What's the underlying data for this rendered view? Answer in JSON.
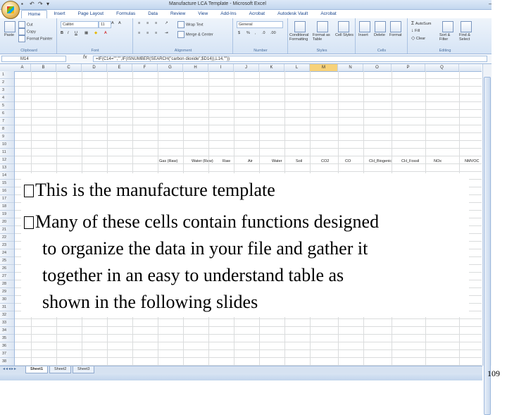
{
  "window": {
    "title": "Manufacture LCA Template - Microsoft Excel",
    "controls": [
      "–",
      "□",
      "✕"
    ]
  },
  "ribbon": {
    "tabs": [
      "Home",
      "Insert",
      "Page Layout",
      "Formulas",
      "Data",
      "Review",
      "View",
      "Add-Ins",
      "Acrobat",
      "Autodesk Vault",
      "Acrobat"
    ],
    "active_tab": "Home",
    "groups": [
      "Clipboard",
      "Font",
      "Alignment",
      "Number",
      "Styles",
      "Cells",
      "Editing"
    ],
    "clipboard": {
      "paste": "Paste",
      "cut": "Cut",
      "copy": "Copy",
      "format_painter": "Format Painter"
    },
    "font": {
      "name": "Calibri",
      "size": "11"
    },
    "alignment": {
      "wrap_text": "Wrap Text",
      "merge_center": "Merge & Center"
    },
    "number": {
      "format": "General"
    },
    "styles": {
      "conditional": "Conditional Formatting",
      "format_table": "Format as Table",
      "cell_styles": "Cell Styles"
    },
    "cells": {
      "insert": "Insert",
      "delete": "Delete",
      "format": "Format"
    },
    "editing": {
      "autosum": "AutoSum",
      "fill": "Fill",
      "clear": "Clear",
      "sort_filter": "Sort & Filter",
      "find_select": "Find & Select"
    }
  },
  "formula_bar": {
    "name_box": "M14",
    "fx": "fx",
    "formula": "=IF(C14=\"\",\"\",IF(ISNUMBER(SEARCH(\"carbon dioxide\",$D14)),L14,\"\"))"
  },
  "grid": {
    "columns": [
      "A",
      "B",
      "C",
      "D",
      "E",
      "F",
      "G",
      "H",
      "I",
      "J",
      "K",
      "L",
      "M",
      "N",
      "O",
      "P",
      "Q",
      "R"
    ],
    "selected_column": "M",
    "rows": [
      "1",
      "2",
      "3",
      "4",
      "5",
      "6",
      "7",
      "8",
      "9",
      "10",
      "11",
      "12",
      "13",
      "14",
      "15",
      "16",
      "17",
      "18",
      "19",
      "20",
      "21",
      "22",
      "23",
      "24",
      "25",
      "26",
      "27",
      "28",
      "29",
      "30",
      "31",
      "32",
      "33",
      "34",
      "35",
      "36",
      "37",
      "38"
    ],
    "header_row": [
      "Gas (Raw)",
      "Water (Raw)",
      "Raw",
      "Air",
      "Water",
      "Soil",
      "CO2",
      "CO",
      "CH_Biogenic",
      "CH_Fossil",
      "NOx",
      "NMVOC"
    ]
  },
  "sheets": {
    "tabs": [
      "Sheet1",
      "Sheet2",
      "Sheet3"
    ],
    "active": "Sheet1"
  },
  "slide": {
    "bullets": [
      "This is the manufacture template",
      "Many of these cells contain functions designed"
    ],
    "continuation": [
      "to organize the data in your file and gather it",
      "together in an easy to understand table as",
      "shown in the following slides"
    ],
    "page_number": "109"
  }
}
